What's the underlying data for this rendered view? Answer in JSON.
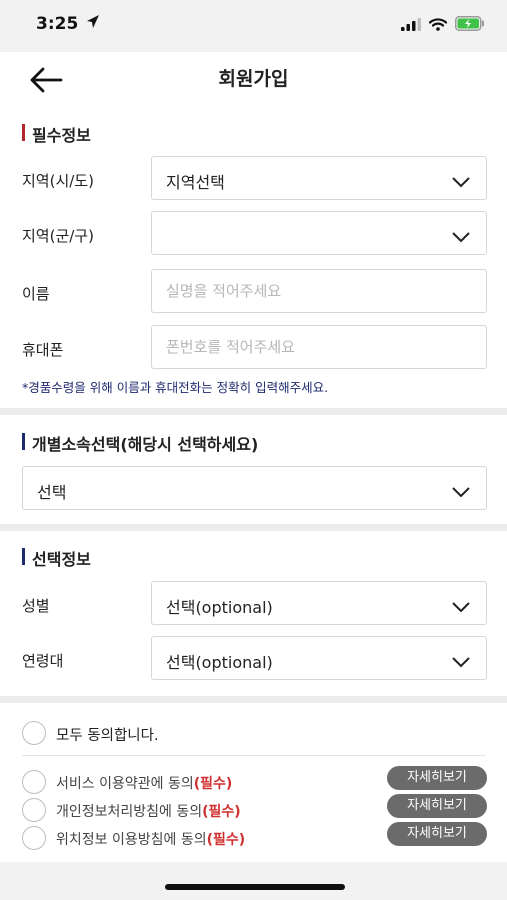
{
  "status": {
    "time": "3:25"
  },
  "header": {
    "title": "회원가입"
  },
  "required": {
    "section_title": "필수정보",
    "region_city_label": "지역(시/도)",
    "region_city_value": "지역선택",
    "region_district_label": "지역(군/구)",
    "region_district_value": "",
    "name_label": "이름",
    "name_placeholder": "실명을 적어주세요",
    "phone_label": "휴대폰",
    "phone_placeholder": "폰번호를 적어주세요",
    "note": "*경품수령을 위해 이름과 휴대전화는 정확히 입력해주세요."
  },
  "affiliation": {
    "section_title": "개별소속선택(해당시 선택하세요)",
    "value": "선택"
  },
  "optional": {
    "section_title": "선택정보",
    "gender_label": "성별",
    "gender_value": "선택(optional)",
    "age_label": "연령대",
    "age_value": "선택(optional)"
  },
  "agreements": {
    "all_label": "모두 동의합니다.",
    "items": [
      {
        "text": "서비스 이용약관에 동의",
        "required": "(필수)",
        "button": "자세히보기"
      },
      {
        "text": "개인정보처리방침에 동의",
        "required": "(필수)",
        "button": "자세히보기"
      },
      {
        "text": "위치정보 이용방침에 동의",
        "required": "(필수)",
        "button": "자세히보기"
      }
    ]
  },
  "icons": {
    "location": "location-arrow-icon",
    "signal": "signal-icon",
    "wifi": "wifi-icon",
    "battery": "battery-charging-icon",
    "back": "back-arrow-icon",
    "chevron": "chevron-down-icon"
  },
  "colors": {
    "required_accent": "#b3262e",
    "section_accent": "#1e2a6e",
    "required_text": "#d0302f",
    "battery": "#3fc14a"
  }
}
